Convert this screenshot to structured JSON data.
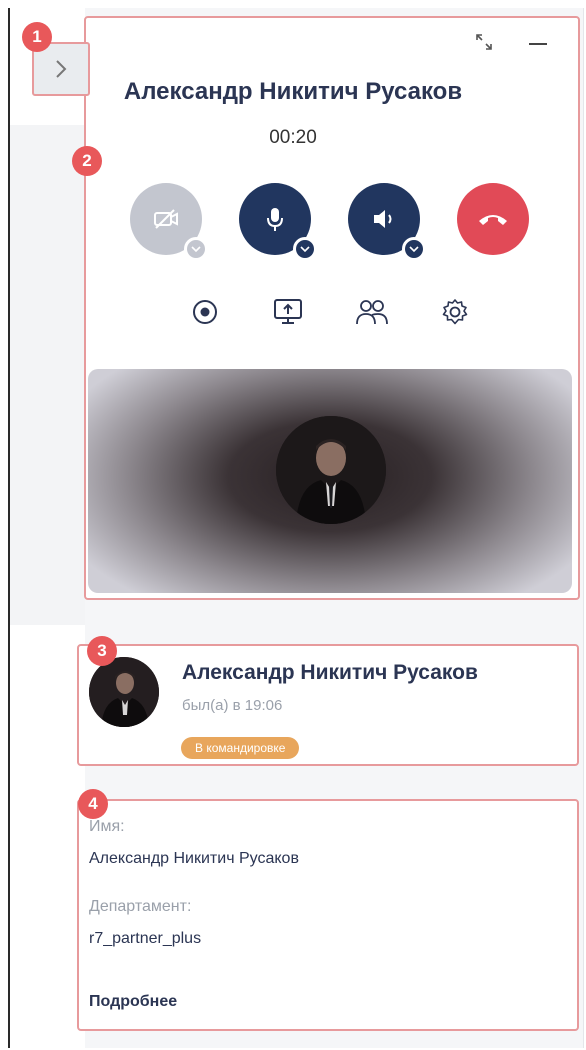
{
  "callouts": [
    "1",
    "2",
    "3",
    "4"
  ],
  "call": {
    "name": "Александр Никитич Русаков",
    "timer": "00:20"
  },
  "contact": {
    "name": "Александр Никитич Русаков",
    "last_seen": "был(а) в 19:06",
    "status": "В командировке"
  },
  "info": {
    "name_label": "Имя:",
    "name_value": "Александр Никитич Русаков",
    "dept_label": "Департамент:",
    "dept_value": "r7_partner_plus",
    "more_link": "Подробнее"
  },
  "icons": {
    "collapse": "chevron-right-icon",
    "expand": "expand-icon",
    "minimize": "minimize-icon",
    "camera": "camera-off-icon",
    "mic": "microphone-icon",
    "speaker": "speaker-icon",
    "hangup": "phone-hangup-icon",
    "record": "record-icon",
    "screen": "screen-share-icon",
    "participants": "participants-icon",
    "settings": "gear-icon"
  },
  "colors": {
    "accent_blue": "#21365f",
    "hangup_red": "#e14a57",
    "disabled_gray": "#c3c6cf",
    "status_orange": "#e8a65c",
    "callout_red": "#e8585a"
  }
}
